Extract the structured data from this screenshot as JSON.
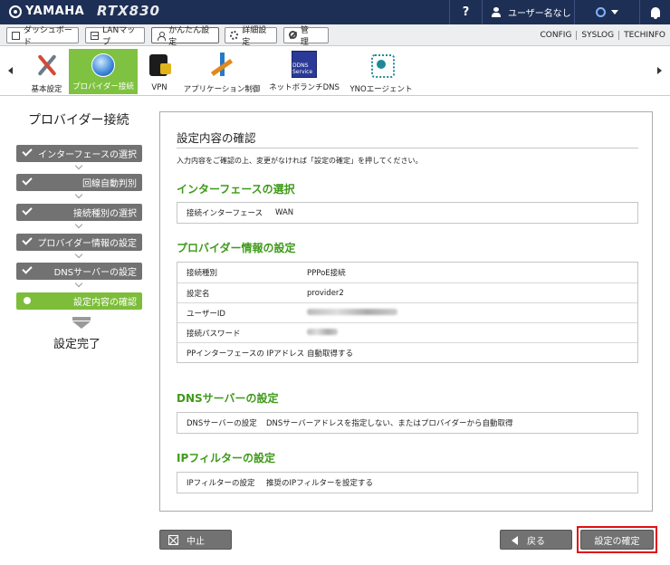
{
  "header": {
    "brand": "YAMAHA",
    "model": "RTX830",
    "help": "?",
    "user": "ユーザー名なし"
  },
  "tabs": [
    {
      "label": "ダッシュボード"
    },
    {
      "label": "LANマップ"
    },
    {
      "label": "かんたん設定"
    },
    {
      "label": "詳細設定"
    },
    {
      "label": "管　理"
    }
  ],
  "toplinks": [
    "CONFIG",
    "SYSLOG",
    "TECHINFO"
  ],
  "menu": [
    {
      "label": "基本設定",
      "icon": "tools-icon"
    },
    {
      "label": "プロバイダー接続",
      "icon": "globe-icon"
    },
    {
      "label": "VPN",
      "icon": "vpn-icon"
    },
    {
      "label": "アプリケーション制御",
      "icon": "app-control-icon"
    },
    {
      "label": "ネットボランチDNS",
      "icon": "dns-service-icon",
      "icon_text": "DDNS Service"
    },
    {
      "label": "YNOエージェント",
      "icon": "yno-icon"
    }
  ],
  "sidebar": {
    "title": "プロバイダー接続",
    "steps": [
      {
        "label": "インターフェースの選択"
      },
      {
        "label": "回線自動判別"
      },
      {
        "label": "接続種別の選択"
      },
      {
        "label": "プロバイダー情報の設定"
      },
      {
        "label": "DNSサーバーの設定"
      },
      {
        "label": "設定内容の確認"
      }
    ],
    "done": "設定完了"
  },
  "main": {
    "title": "設定内容の確認",
    "description": "入力内容をご確認の上、変更がなければ「設定の確定」を押してください。",
    "sections": [
      {
        "heading": "インターフェースの選択",
        "rows": [
          {
            "key": "接続インターフェース",
            "value": "WAN"
          }
        ]
      },
      {
        "heading": "プロバイダー情報の設定",
        "rows": [
          {
            "key": "接続種別",
            "value": "PPPoE接続"
          },
          {
            "key": "設定名",
            "value": "provider2"
          },
          {
            "key": "ユーザーID",
            "value": ""
          },
          {
            "key": "接続パスワード",
            "value": ""
          },
          {
            "key": "PPインターフェースの IPアドレス",
            "value": "自動取得する"
          }
        ]
      },
      {
        "heading": "DNSサーバーの設定",
        "rows": [
          {
            "key": "DNSサーバーの設定",
            "value": "DNSサーバーアドレスを指定しない、またはプロバイダーから自動取得"
          }
        ]
      },
      {
        "heading": "IPフィルターの設定",
        "rows": [
          {
            "key": "IPフィルターの設定",
            "value": "推奨のIPフィルターを設定する"
          }
        ]
      }
    ]
  },
  "buttons": {
    "cancel": "中止",
    "back": "戻る",
    "confirm": "設定の確定"
  },
  "colors": {
    "topbar": "#1e2f55",
    "accent_green": "#7dbd3a",
    "heading_green": "#3f9a1a",
    "step_gray": "#727272",
    "highlight_red": "#e01010"
  }
}
